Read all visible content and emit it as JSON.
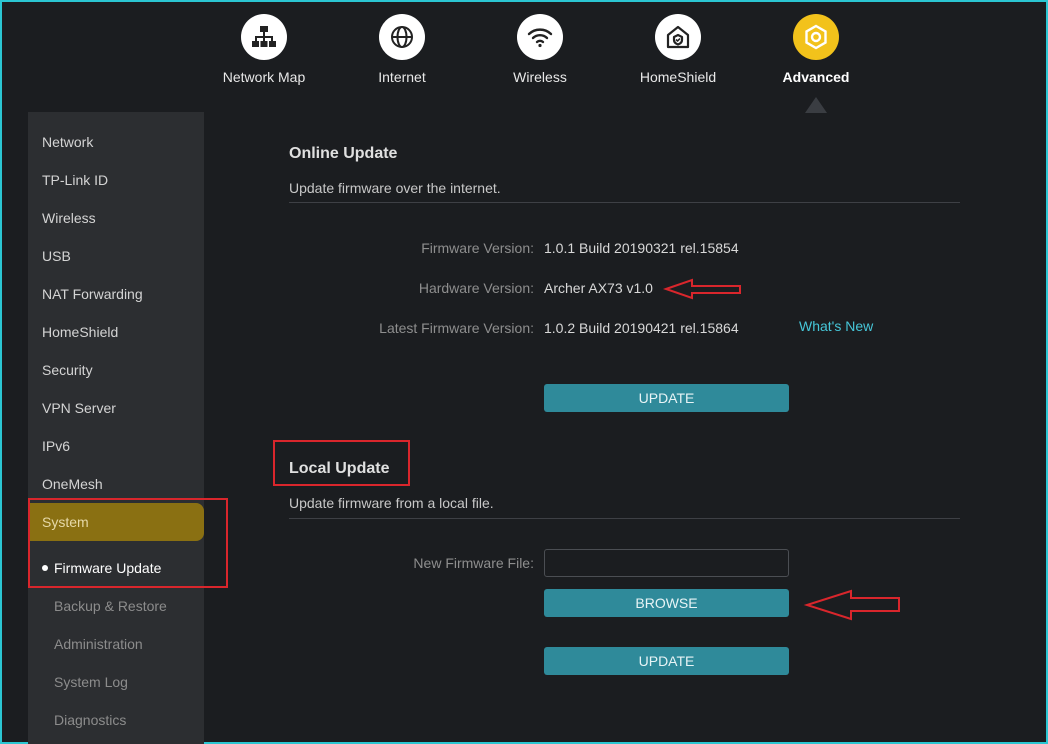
{
  "nav": {
    "items": [
      {
        "label": "Network Map",
        "icon": "network-map-icon"
      },
      {
        "label": "Internet",
        "icon": "globe-icon"
      },
      {
        "label": "Wireless",
        "icon": "wifi-icon"
      },
      {
        "label": "HomeShield",
        "icon": "home-shield-icon"
      },
      {
        "label": "Advanced",
        "icon": "gear-icon",
        "active": true
      }
    ]
  },
  "sidebar": {
    "items": [
      "Network",
      "TP-Link ID",
      "Wireless",
      "USB",
      "NAT Forwarding",
      "HomeShield",
      "Security",
      "VPN Server",
      "IPv6",
      "OneMesh",
      "System"
    ],
    "active": "System",
    "subitems": [
      "Firmware Update",
      "Backup & Restore",
      "Administration",
      "System Log",
      "Diagnostics"
    ],
    "active_sub": "Firmware Update"
  },
  "online_update": {
    "title": "Online Update",
    "description": "Update firmware over the internet.",
    "firmware_version_label": "Firmware Version:",
    "firmware_version": "1.0.1 Build 20190321 rel.15854",
    "hardware_version_label": "Hardware Version:",
    "hardware_version": "Archer AX73 v1.0",
    "latest_firmware_label": "Latest Firmware Version:",
    "latest_firmware": "1.0.2 Build 20190421 rel.15864",
    "whats_new": "What's New",
    "update_button": "UPDATE"
  },
  "local_update": {
    "title": "Local Update",
    "description": "Update firmware from a local file.",
    "file_label": "New Firmware File:",
    "file_value": "",
    "browse_button": "BROWSE",
    "update_button": "UPDATE"
  },
  "colors": {
    "accent": "#2f8a9a",
    "active_nav": "#f2c21b",
    "active_sidebar": "#8a7012",
    "annotation": "#d9262c",
    "link": "#46c6d8"
  }
}
